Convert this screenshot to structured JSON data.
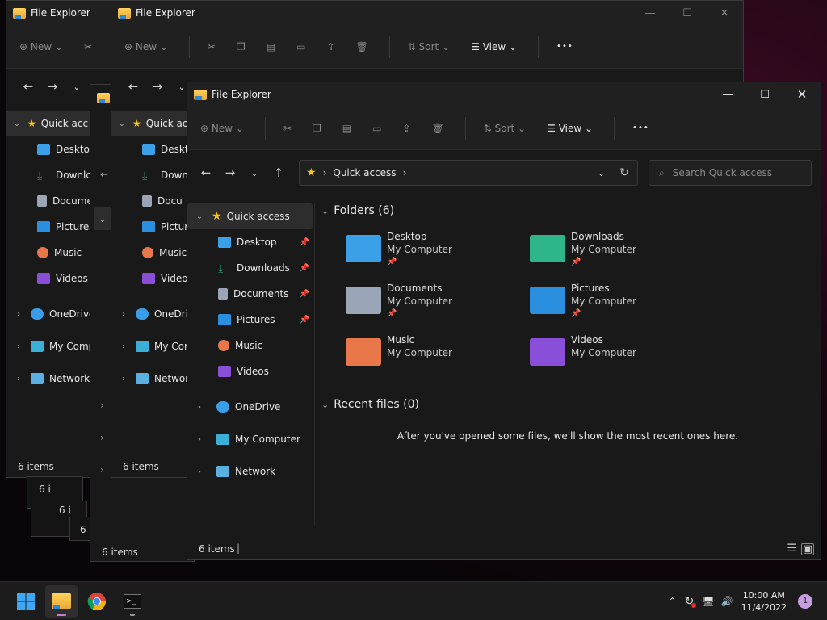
{
  "window_title": "File Explorer",
  "toolbar": {
    "new_label": "New",
    "sort_label": "Sort",
    "view_label": "View",
    "more_label": "•••"
  },
  "address": {
    "path": "Quick access",
    "search_placeholder": "Search Quick access"
  },
  "sidebar": {
    "quick_access": "Quick access",
    "pinned": [
      {
        "label": "Desktop",
        "icon": "desktop-icon"
      },
      {
        "label": "Downloads",
        "icon": "downloads-icon"
      },
      {
        "label": "Documents",
        "icon": "documents-icon"
      },
      {
        "label": "Pictures",
        "icon": "pictures-icon"
      },
      {
        "label": "Music",
        "icon": "music-icon"
      },
      {
        "label": "Videos",
        "icon": "videos-icon"
      }
    ],
    "onedrive": "OneDrive",
    "my_computer": "My Computer",
    "network": "Network"
  },
  "back_sidebar": {
    "quick_access": "Quick acc",
    "quick_access_mid": "Quick ac",
    "items": [
      "Desktop",
      "Downloa",
      "Docume",
      "Pictures",
      "Music",
      "Videos"
    ],
    "items_mid": [
      "Deskto",
      "Downl",
      "Docu",
      "Picture",
      "Music",
      "Video"
    ],
    "onedrive": "OneDrive",
    "onedrive_mid": "OneDriv",
    "my_computer": "My Comp",
    "my_computer_mid": "My Con",
    "network": "Network",
    "network_mid": "Networ"
  },
  "content": {
    "folders_header": "Folders (6)",
    "folders": [
      {
        "name": "Desktop",
        "location": "My Computer",
        "pinned": true,
        "color": "#3aa0e8"
      },
      {
        "name": "Downloads",
        "location": "My Computer",
        "pinned": true,
        "color": "#2fb58a"
      },
      {
        "name": "Documents",
        "location": "My Computer",
        "pinned": true,
        "color": "#9aa6b8"
      },
      {
        "name": "Pictures",
        "location": "My Computer",
        "pinned": true,
        "color": "#2b8fe0"
      },
      {
        "name": "Music",
        "location": "My Computer",
        "pinned": false,
        "color": "#e8774a"
      },
      {
        "name": "Videos",
        "location": "My Computer",
        "pinned": false,
        "color": "#8a4fd8"
      }
    ],
    "recent_header": "Recent files (0)",
    "recent_empty": "After you've opened some files, we'll show the most recent ones here."
  },
  "status": {
    "item_count": "6 items",
    "item_count_short": "6 i"
  },
  "taskbar": {
    "time": "10:00 AM",
    "date": "11/4/2022",
    "notification_count": "1"
  }
}
